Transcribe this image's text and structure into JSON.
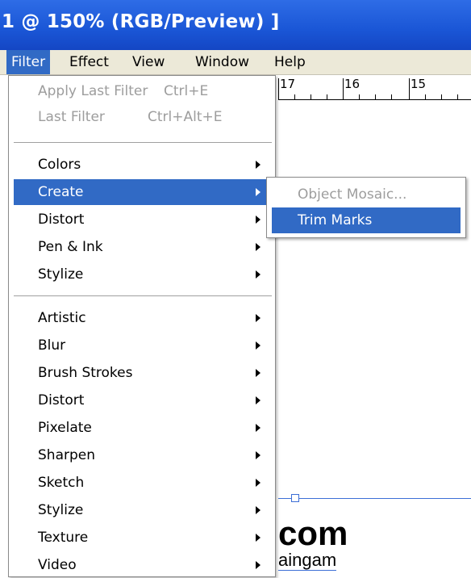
{
  "window": {
    "title": "1 @ 150% (RGB/Preview) ]"
  },
  "menubar": {
    "items": [
      {
        "label": "Filter"
      },
      {
        "label": "Effect"
      },
      {
        "label": "View"
      },
      {
        "label": "Window"
      },
      {
        "label": "Help"
      }
    ]
  },
  "ruler": {
    "numbers": [
      "17",
      "16",
      "15"
    ]
  },
  "filter_menu": {
    "apply_last_filter": {
      "label": "Apply Last Filter",
      "shortcut": "Ctrl+E"
    },
    "last_filter": {
      "label": "Last Filter",
      "shortcut": "Ctrl+Alt+E"
    },
    "group1": [
      "Colors",
      "Create",
      "Distort",
      "Pen & Ink",
      "Stylize"
    ],
    "group2": [
      "Artistic",
      "Blur",
      "Brush Strokes",
      "Distort",
      "Pixelate",
      "Sharpen",
      "Sketch",
      "Stylize",
      "Texture",
      "Video"
    ]
  },
  "create_submenu": {
    "items": [
      "Object Mosaic...",
      "Trim Marks"
    ]
  },
  "canvas": {
    "big_text": "com",
    "small_text": "aingam"
  },
  "colors": {
    "accent": "#316ac5",
    "titlebar": "#1a56d6",
    "menubar": "#ece9d8"
  }
}
